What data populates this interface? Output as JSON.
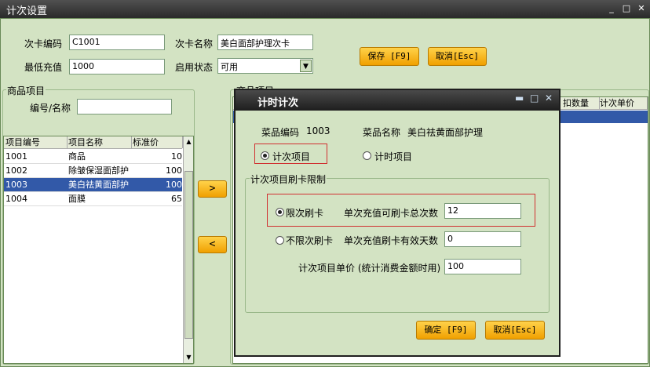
{
  "window": {
    "title": "计次设置"
  },
  "form": {
    "card_code_label": "次卡编码",
    "card_code_value": "C1001",
    "card_name_label": "次卡名称",
    "card_name_value": "美白面部护理次卡",
    "min_recharge_label": "最低充值",
    "min_recharge_value": "1000",
    "status_label": "启用状态",
    "status_value": "可用",
    "save_label": "保存 [F9]",
    "cancel_label": "取消[Esc]"
  },
  "left_panel": {
    "title": "商品项目",
    "search_label": "编号/名称",
    "columns": [
      "项目编号",
      "项目名称",
      "标准价"
    ],
    "rows": [
      {
        "code": "1001",
        "name": "商品",
        "price": "10"
      },
      {
        "code": "1002",
        "name": "除皱保湿面部护",
        "price": "100"
      },
      {
        "code": "1003",
        "name": "美白祛黄面部护",
        "price": "100"
      },
      {
        "code": "1004",
        "name": "面膜",
        "price": "65"
      }
    ],
    "selected_index": 2
  },
  "move_buttons": {
    "add": ">",
    "remove": "<"
  },
  "right_panel": {
    "title": "商品项目",
    "columns": [
      "扣数量",
      "计次单价"
    ]
  },
  "dialog": {
    "title": "计时计次",
    "item_code_label": "菜品编码",
    "item_code_value": "1003",
    "item_name_label": "菜品名称",
    "item_name_value": "美白祛黄面部护理",
    "radio_count_label": "计次项目",
    "radio_time_label": "计时项目",
    "group_title": "计次项目刷卡限制",
    "limited_label": "限次刷卡",
    "max_times_label": "单次充值可刷卡总次数",
    "max_times_value": "12",
    "unlimited_label": "不限次刷卡",
    "valid_days_label": "单次充值刷卡有效天数",
    "valid_days_value": "0",
    "unit_price_label": "计次项目单价 (统计消费金额时用)",
    "unit_price_value": "100",
    "ok_label": "确定 [F9]",
    "cancel_label": "取消[Esc]"
  }
}
